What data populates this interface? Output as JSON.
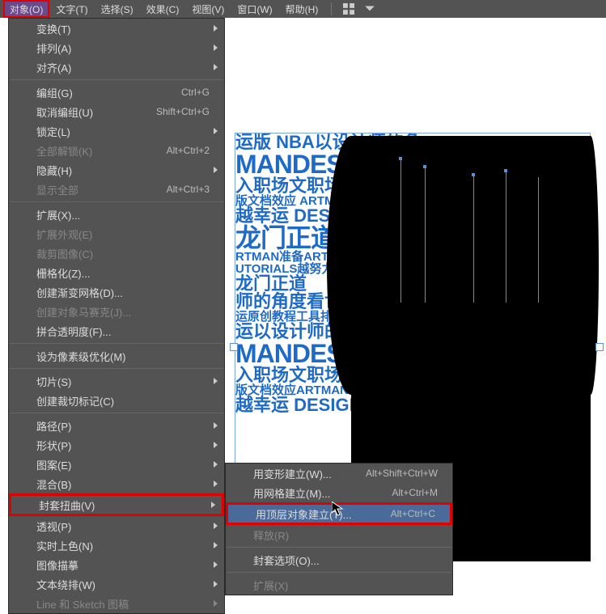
{
  "menubar": {
    "items": [
      "对象(O)",
      "文字(T)",
      "选择(S)",
      "效果(C)",
      "视图(V)",
      "窗口(W)",
      "帮助(H)"
    ]
  },
  "menu": {
    "transform": "变换(T)",
    "arrange": "排列(A)",
    "align": "对齐(A)",
    "group": "编组(G)",
    "group_sc": "Ctrl+G",
    "ungroup": "取消编组(U)",
    "ungroup_sc": "Shift+Ctrl+G",
    "lock": "锁定(L)",
    "unlockall": "全部解锁(K)",
    "unlockall_sc": "Alt+Ctrl+2",
    "hide": "隐藏(H)",
    "showall": "显示全部",
    "showall_sc": "Alt+Ctrl+3",
    "expand": "扩展(X)...",
    "expandapp": "扩展外观(E)",
    "crop": "裁剪图像(C)",
    "raster": "栅格化(Z)...",
    "meshgrad": "创建渐变网格(D)...",
    "mosaic": "创建对象马赛克(J)...",
    "flatten": "拼合透明度(F)...",
    "pixperf": "设为像素级优化(M)",
    "slice": "切片(S)",
    "trimmarks": "创建裁切标记(C)",
    "path": "路径(P)",
    "shape": "形状(P)",
    "pattern": "图案(E)",
    "blend": "混合(B)",
    "envelope": "封套扭曲(V)",
    "perspective": "透视(P)",
    "livepaint": "实时上色(N)",
    "imgtrace": "图像描摹",
    "textwarp": "文本绕排(W)",
    "linesketch": "Line 和 Sketch 图稿"
  },
  "submenu": {
    "warp": "用变形建立(W)...",
    "warp_sc": "Alt+Shift+Ctrl+W",
    "mesh": "用网格建立(M)...",
    "mesh_sc": "Alt+Ctrl+M",
    "top": "用顶层对象建立(T)...",
    "top_sc": "Alt+Ctrl+C",
    "release": "释放(R)",
    "options": "封套选项(O)...",
    "expand": "扩展(X)"
  },
  "art": {
    "l1": "运版 NBA以设计师的角",
    "l2": "MANDESI",
    "l3": "入职场文职场进阶",
    "l4": "越幸运 DESIGN",
    "l5": "龙门正道",
    "l6": "龙门正道",
    "l7": "师的角度看世界",
    "l8": "运原创教程工具排版",
    "l9": "运以设计师的角",
    "l10": "MANDESIG",
    "l11": "入职场文职场进阶庞",
    "l12": "版文档效应ARTMAN",
    "l13": "越幸运 DESIGN门"
  }
}
